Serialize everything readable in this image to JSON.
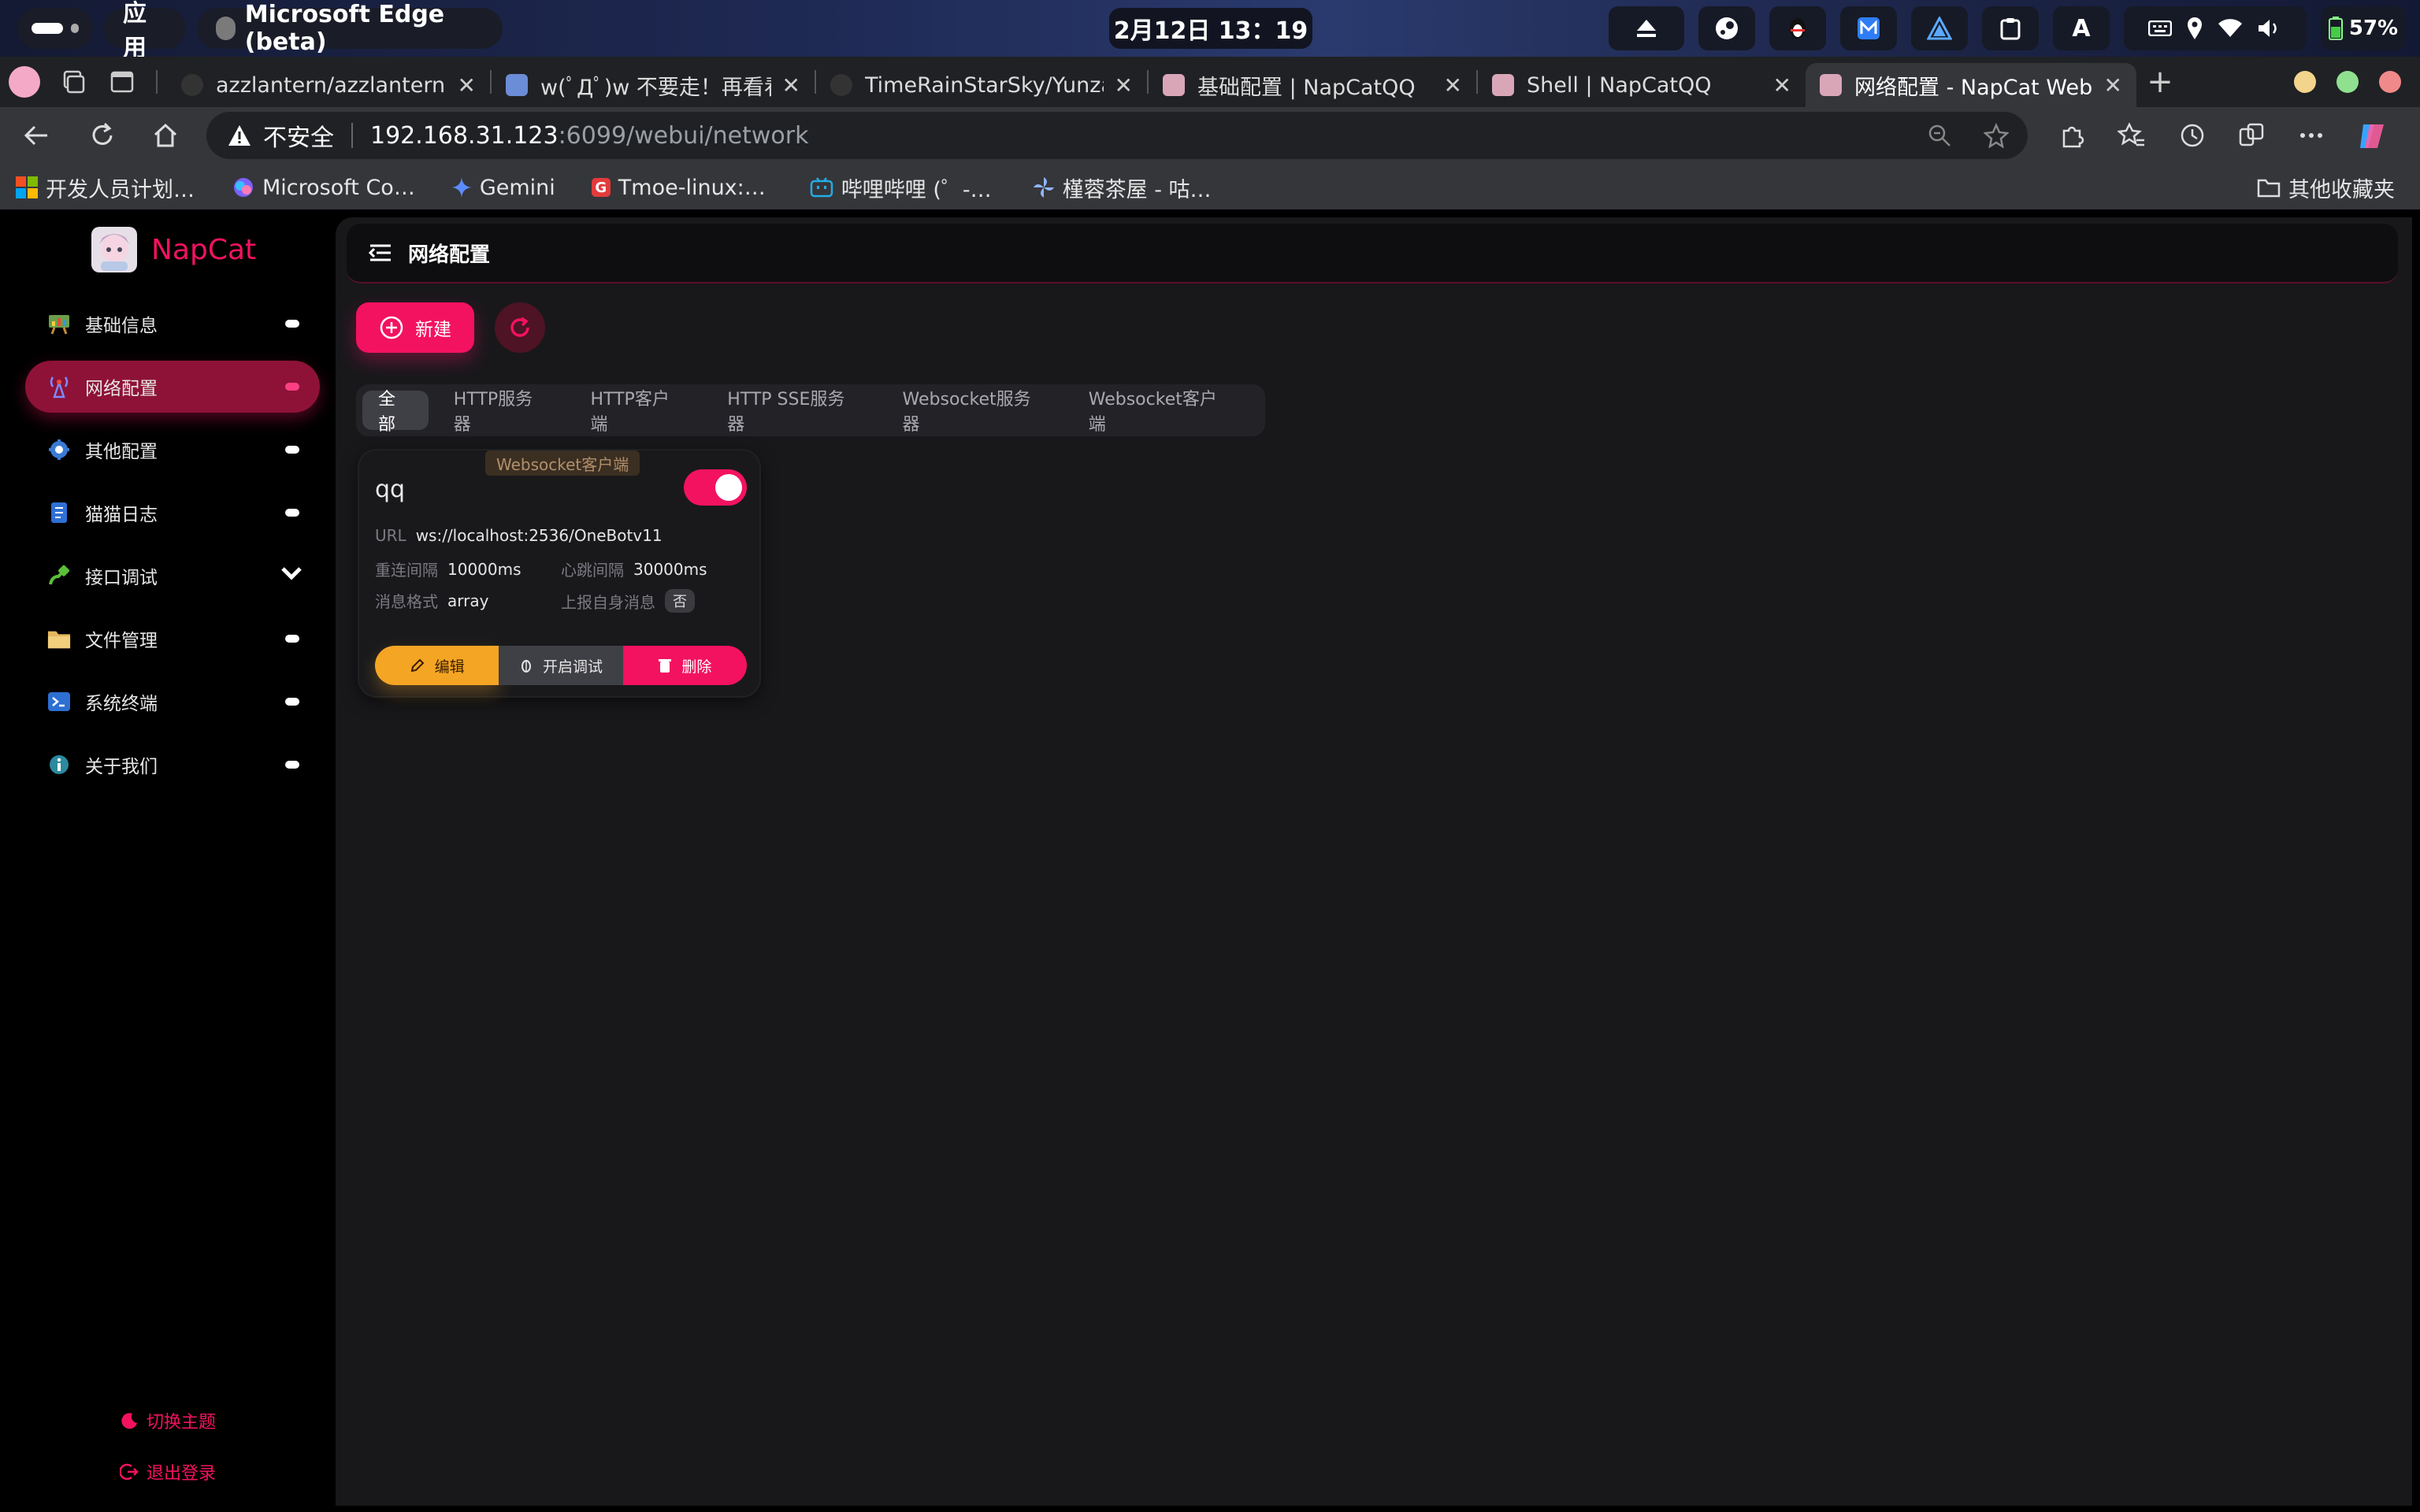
{
  "system": {
    "apps_label": "应用",
    "window_title": "Microsoft Edge (beta)",
    "clock": "2月12日  13：19",
    "battery": "57%"
  },
  "browser": {
    "tabs": [
      {
        "title": "azzlantern/azzlantern.gi"
      },
      {
        "title": "w(ﾟДﾟ)w 不要走！再看看"
      },
      {
        "title": "TimeRainStarSky/Yunza"
      },
      {
        "title": "基础配置 | NapCatQQ"
      },
      {
        "title": "Shell | NapCatQQ"
      },
      {
        "title": "网络配置 - NapCat Web"
      }
    ],
    "address": {
      "security": "不安全",
      "host": "192.168.31.123",
      "path": ":6099/webui/network"
    },
    "bookmarks": [
      "开发人员计划…",
      "Microsoft Co…",
      "Gemini",
      "Tmoe-linux:…",
      "哔哩哔哩 (゜-…",
      "槿蓉茶屋 - 咕…"
    ],
    "other_bookmarks": "其他收藏夹"
  },
  "sidebar": {
    "brand": "NapCat",
    "items": [
      {
        "label": "基础信息"
      },
      {
        "label": "网络配置"
      },
      {
        "label": "其他配置"
      },
      {
        "label": "猫猫日志"
      },
      {
        "label": "接口调试"
      },
      {
        "label": "文件管理"
      },
      {
        "label": "系统终端"
      },
      {
        "label": "关于我们"
      }
    ],
    "theme_toggle": "切换主题",
    "logout": "退出登录"
  },
  "page": {
    "title": "网络配置",
    "new_button": "新建",
    "filter_tabs": [
      "全部",
      "HTTP服务器",
      "HTTP客户端",
      "HTTP SSE服务器",
      "Websocket服务器",
      "Websocket客户端"
    ]
  },
  "card": {
    "type_badge": "Websocket客户端",
    "name": "qq",
    "enabled": true,
    "url_label": "URL",
    "url": "ws://localhost:2536/OneBotv11",
    "reconnect_label": "重连间隔",
    "reconnect": "10000ms",
    "heartbeat_label": "心跳间隔",
    "heartbeat": "30000ms",
    "format_label": "消息格式",
    "format": "array",
    "report_self_label": "上报自身消息",
    "report_self": "否",
    "edit": "编辑",
    "debug": "开启调试",
    "delete": "删除"
  },
  "colors": {
    "accent": "#f31260",
    "warning": "#f5a524",
    "surface": "#18181b"
  }
}
